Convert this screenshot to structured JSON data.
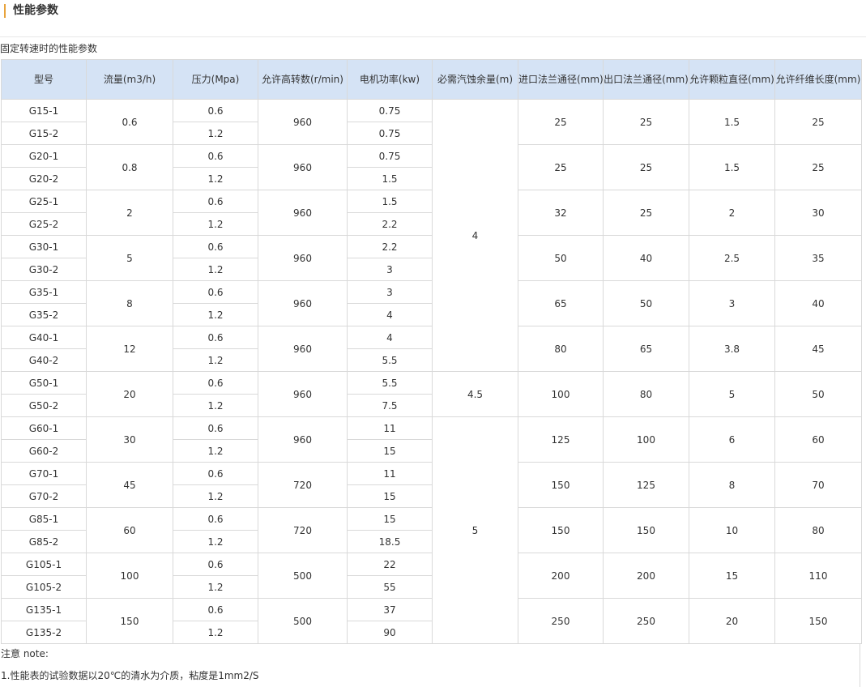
{
  "section": {
    "title": "性能参数"
  },
  "subtitle": "固定转速时的性能参数",
  "table": {
    "headers": [
      "型号",
      "流量(m3/h)",
      "压力(Mpa)",
      "允许高转数(r/min)",
      "电机功率(kw)",
      "必需汽蚀余量(m)",
      "进口法兰通径(mm)",
      "出口法兰通径(mm)",
      "允许颗粒直径(mm)",
      "允许纤维长度(mm)"
    ],
    "groups": [
      {
        "models": [
          "G15-1",
          "G15-2"
        ],
        "flow": "0.6",
        "pressures": [
          "0.6",
          "1.2"
        ],
        "speed": "960",
        "powers": [
          "0.75",
          "0.75"
        ],
        "inlet": "25",
        "outlet": "25",
        "particle": "1.5",
        "fiber": "25"
      },
      {
        "models": [
          "G20-1",
          "G20-2"
        ],
        "flow": "0.8",
        "pressures": [
          "0.6",
          "1.2"
        ],
        "speed": "960",
        "powers": [
          "0.75",
          "1.5"
        ],
        "inlet": "25",
        "outlet": "25",
        "particle": "1.5",
        "fiber": "25"
      },
      {
        "models": [
          "G25-1",
          "G25-2"
        ],
        "flow": "2",
        "pressures": [
          "0.6",
          "1.2"
        ],
        "speed": "960",
        "powers": [
          "1.5",
          "2.2"
        ],
        "inlet": "32",
        "outlet": "25",
        "particle": "2",
        "fiber": "30"
      },
      {
        "models": [
          "G30-1",
          "G30-2"
        ],
        "flow": "5",
        "pressures": [
          "0.6",
          "1.2"
        ],
        "speed": "960",
        "powers": [
          "2.2",
          "3"
        ],
        "inlet": "50",
        "outlet": "40",
        "particle": "2.5",
        "fiber": "35"
      },
      {
        "models": [
          "G35-1",
          "G35-2"
        ],
        "flow": "8",
        "pressures": [
          "0.6",
          "1.2"
        ],
        "speed": "960",
        "powers": [
          "3",
          "4"
        ],
        "inlet": "65",
        "outlet": "50",
        "particle": "3",
        "fiber": "40"
      },
      {
        "models": [
          "G40-1",
          "G40-2"
        ],
        "flow": "12",
        "pressures": [
          "0.6",
          "1.2"
        ],
        "speed": "960",
        "powers": [
          "4",
          "5.5"
        ],
        "inlet": "80",
        "outlet": "65",
        "particle": "3.8",
        "fiber": "45"
      },
      {
        "models": [
          "G50-1",
          "G50-2"
        ],
        "flow": "20",
        "pressures": [
          "0.6",
          "1.2"
        ],
        "speed": "960",
        "powers": [
          "5.5",
          "7.5"
        ],
        "inlet": "100",
        "outlet": "80",
        "particle": "5",
        "fiber": "50"
      },
      {
        "models": [
          "G60-1",
          "G60-2"
        ],
        "flow": "30",
        "pressures": [
          "0.6",
          "1.2"
        ],
        "speed": "960",
        "powers": [
          "11",
          "15"
        ],
        "inlet": "125",
        "outlet": "100",
        "particle": "6",
        "fiber": "60"
      },
      {
        "models": [
          "G70-1",
          "G70-2"
        ],
        "flow": "45",
        "pressures": [
          "0.6",
          "1.2"
        ],
        "speed": "720",
        "powers": [
          "11",
          "15"
        ],
        "inlet": "150",
        "outlet": "125",
        "particle": "8",
        "fiber": "70"
      },
      {
        "models": [
          "G85-1",
          "G85-2"
        ],
        "flow": "60",
        "pressures": [
          "0.6",
          "1.2"
        ],
        "speed": "720",
        "powers": [
          "15",
          "18.5"
        ],
        "inlet": "150",
        "outlet": "150",
        "particle": "10",
        "fiber": "80"
      },
      {
        "models": [
          "G105-1",
          "G105-2"
        ],
        "flow": "100",
        "pressures": [
          "0.6",
          "1.2"
        ],
        "speed": "500",
        "powers": [
          "22",
          "55"
        ],
        "inlet": "200",
        "outlet": "200",
        "particle": "15",
        "fiber": "110"
      },
      {
        "models": [
          "G135-1",
          "G135-2"
        ],
        "flow": "150",
        "pressures": [
          "0.6",
          "1.2"
        ],
        "speed": "500",
        "powers": [
          "37",
          "90"
        ],
        "inlet": "250",
        "outlet": "250",
        "particle": "20",
        "fiber": "150"
      }
    ],
    "npsh_spans": [
      {
        "value": "4",
        "groups": 6
      },
      {
        "value": "4.5",
        "groups": 1
      },
      {
        "value": "5",
        "groups": 5
      }
    ]
  },
  "notes": {
    "label": "注意 note:",
    "items": [
      "1.性能表的试验数据以20℃的清水为介质，粘度是1mm2/S"
    ]
  },
  "colors": {
    "accent": "#e8a33c",
    "header_bg": "#d5e3f5",
    "border": "#d9d9d9"
  }
}
